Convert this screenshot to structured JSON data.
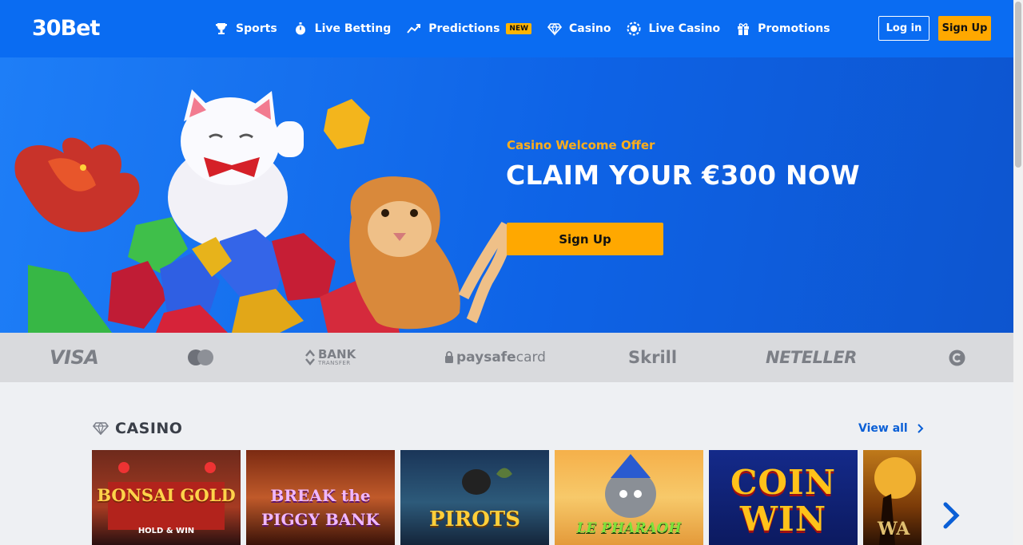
{
  "header": {
    "logo": "30Bet",
    "nav": [
      {
        "label": "Sports",
        "icon": "trophy-icon"
      },
      {
        "label": "Live Betting",
        "icon": "stopwatch-icon"
      },
      {
        "label": "Predictions",
        "icon": "trend-up-icon",
        "badge": "NEW"
      },
      {
        "label": "Casino",
        "icon": "diamond-icon"
      },
      {
        "label": "Live Casino",
        "icon": "chip-icon"
      },
      {
        "label": "Promotions",
        "icon": "gift-icon"
      }
    ],
    "login_label": "Log in",
    "signup_label": "Sign Up"
  },
  "banner": {
    "subtitle": "Casino Welcome Offer",
    "title": "CLAIM YOUR €300 NOW",
    "cta_label": "Sign Up"
  },
  "payments": {
    "visa": "VISA",
    "bank_main": "BANK",
    "bank_sub": "TRANSFER",
    "paysafe_a": "paysafe",
    "paysafe_b": "card",
    "skrill": "Skrill",
    "neteller": "NETELLER"
  },
  "casino": {
    "title": "CASINO",
    "view_all": "View all",
    "games": [
      {
        "title": "BONSAI GOLD",
        "subtitle": "HOLD & WIN"
      },
      {
        "title": "BREAK the PIGGY BANK"
      },
      {
        "title": "PIROTS"
      },
      {
        "title": "LE PHARAOH"
      },
      {
        "title": "COIN WIN"
      },
      {
        "title": "WA"
      }
    ]
  },
  "colors": {
    "brand_blue": "#0a6cf2",
    "accent_orange": "#ffa800",
    "link_blue": "#0a5fd6"
  }
}
